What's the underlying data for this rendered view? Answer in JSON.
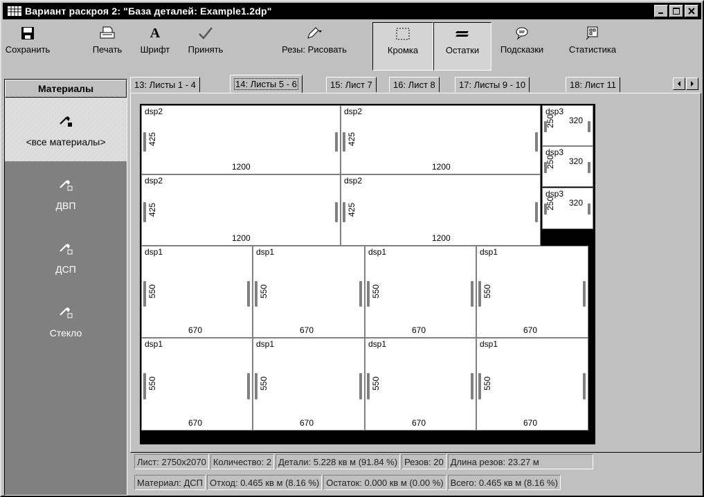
{
  "window": {
    "title": "Вариант раскроя 2: \"База деталей: Example1.2dp\""
  },
  "toolbar": {
    "save": "Сохранить",
    "print": "Печать",
    "font": "Шрифт",
    "accept": "Принять",
    "cuts": "Резы: Рисовать",
    "edge": "Кромка",
    "remains": "Остатки",
    "hints": "Подсказки",
    "stats": "Статистика"
  },
  "tabs": [
    "13: Листы 1 - 4",
    "14: Листы 5 - 6",
    "15: Лист 7",
    "16: Лист 8",
    "17: Листы 9 - 10",
    "18: Лист 11"
  ],
  "active_tab": 1,
  "materials": {
    "header": "Материалы",
    "items": [
      "<все материалы>",
      "ДВП",
      "ДСП",
      "Стекло"
    ],
    "selected": 0
  },
  "parts": {
    "dsp2": {
      "name": "dsp2",
      "w": "1200",
      "h": "425"
    },
    "dsp3": {
      "name": "dsp3",
      "w": "320",
      "h": "250"
    },
    "dsp1": {
      "name": "dsp1",
      "w": "670",
      "h": "550"
    }
  },
  "status": {
    "row1": [
      "Лист: 2750x2070",
      "Количество: 2",
      "Детали: 5.228 кв м (91.84 %)",
      "Резов: 20",
      "Длина резов: 23.27 м"
    ],
    "row2": [
      "Материал: ДСП",
      "Отход: 0.465 кв м (8.16 %)",
      "Остаток: 0.000 кв м (0.00 %)",
      "Всего: 0.465 кв м (8.16 %)"
    ]
  }
}
